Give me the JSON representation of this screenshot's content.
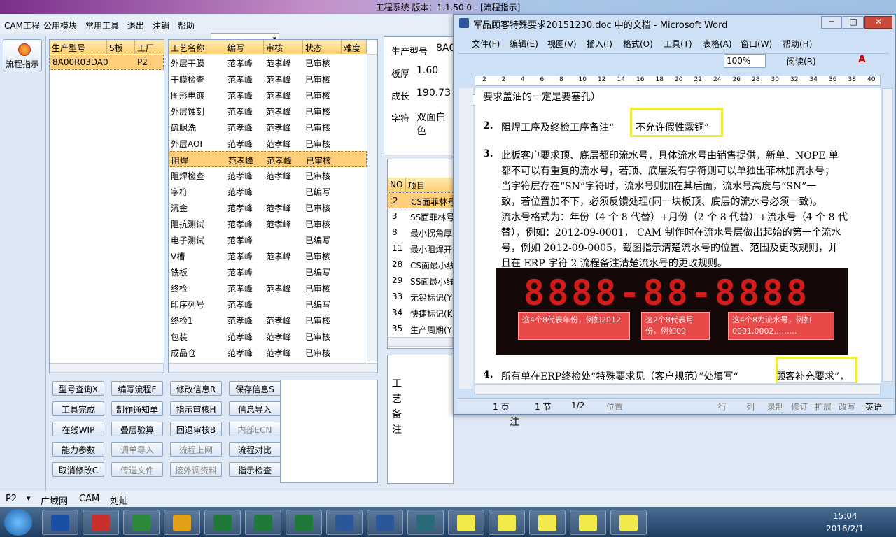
{
  "app": {
    "title": "工程系统  版本：1.1.50.0 - [流程指示]",
    "combo_value": ""
  },
  "menu": [
    "CAM工程",
    "公用模块",
    "常用工具",
    "退出",
    "注销",
    "帮助"
  ],
  "leftbar": {
    "flow_label": "流程指示"
  },
  "model_table": {
    "headers": [
      "生产型号",
      "S板",
      "工厂"
    ],
    "rows": [
      [
        "8A00R03DA0",
        "",
        "P2"
      ]
    ]
  },
  "process_table": {
    "headers": [
      "工艺名称",
      "编写",
      "审核",
      "状态",
      "难度"
    ],
    "rows": [
      [
        "外层干膜",
        "范孝峰",
        "范孝峰",
        "已审核",
        ""
      ],
      [
        "干膜检查",
        "范孝峰",
        "范孝峰",
        "已审核",
        ""
      ],
      [
        "图形电镀",
        "范孝峰",
        "范孝峰",
        "已审核",
        ""
      ],
      [
        "外层蚀刻",
        "范孝峰",
        "范孝峰",
        "已审核",
        ""
      ],
      [
        "硫脲洗",
        "范孝峰",
        "范孝峰",
        "已审核",
        ""
      ],
      [
        "外层AOI",
        "范孝峰",
        "范孝峰",
        "已审核",
        ""
      ],
      [
        "阻焊",
        "范孝峰",
        "范孝峰",
        "已审核",
        ""
      ],
      [
        "阻焊检查",
        "范孝峰",
        "范孝峰",
        "已审核",
        ""
      ],
      [
        "字符",
        "范孝峰",
        "",
        "已编写",
        ""
      ],
      [
        "沉金",
        "范孝峰",
        "范孝峰",
        "已审核",
        ""
      ],
      [
        "阻抗测试",
        "范孝峰",
        "范孝峰",
        "已审核",
        ""
      ],
      [
        "电子测试",
        "范孝峰",
        "",
        "已编写",
        ""
      ],
      [
        "V槽",
        "范孝峰",
        "范孝峰",
        "已审核",
        ""
      ],
      [
        "铣板",
        "范孝峰",
        "",
        "已编写",
        ""
      ],
      [
        "终检",
        "范孝峰",
        "范孝峰",
        "已审核",
        ""
      ],
      [
        "印序列号",
        "范孝峰",
        "",
        "已编写",
        ""
      ],
      [
        "终检1",
        "范孝峰",
        "范孝峰",
        "已审核",
        ""
      ],
      [
        "包装",
        "范孝峰",
        "范孝峰",
        "已审核",
        ""
      ],
      [
        "成品仓",
        "范孝峰",
        "范孝峰",
        "已审核",
        ""
      ]
    ],
    "selected": 6
  },
  "buttons": [
    [
      "型号查询X",
      "编写流程F",
      "修改信息R",
      "保存信息S"
    ],
    [
      "工具完成",
      "制作通知单",
      "指示审核H",
      "信息导入"
    ],
    [
      "在线WIP",
      "叠层验算",
      "回退审核B",
      "内部ECN"
    ],
    [
      "能力参数",
      "调单导入",
      "流程上网",
      "流程对比"
    ],
    [
      "取消修改C",
      "传送文件",
      "接外调资料",
      "指示检查"
    ]
  ],
  "info": {
    "model_label": "生产型号",
    "model_value": "8A0",
    "thick_label": "板厚",
    "thick_value": "1.60",
    "len_label": "成长",
    "len_value": "190.73",
    "char_label": "字符",
    "char_value": "双面白色"
  },
  "items_table": {
    "headers": [
      "NO",
      "项目"
    ],
    "rows": [
      [
        "2",
        "CS面菲林号"
      ],
      [
        "3",
        "SS面菲林号"
      ],
      [
        "8",
        "最小拐角厚"
      ],
      [
        "11",
        "最小阻焊开"
      ],
      [
        "28",
        "CS面最小线"
      ],
      [
        "29",
        "SS面最小线"
      ],
      [
        "33",
        "无铅标记(Y"
      ],
      [
        "34",
        "快捷标记(K"
      ],
      [
        "35",
        "生产周期(Y"
      ]
    ]
  },
  "note_label": "工艺备注",
  "note_label2": "注",
  "word": {
    "title": "军品顾客特殊要求20151230.doc 中的文档 - Microsoft Word",
    "menu": [
      "文件(F)",
      "编辑(E)",
      "视图(V)",
      "插入(I)",
      "格式(O)",
      "工具(T)",
      "表格(A)",
      "窗口(W)",
      "帮助(H)"
    ],
    "zoom": "100%",
    "read": "阅读(R)",
    "ruler": [
      "2",
      "2",
      "4",
      "6",
      "8",
      "10",
      "12",
      "14",
      "16",
      "18",
      "20",
      "22",
      "24",
      "26",
      "28",
      "30",
      "32",
      "34",
      "36",
      "38",
      "40"
    ],
    "lines": {
      "l0": "要求盖油的一定是要塞孔）",
      "n2": "2.",
      "l2a": "阻焊工序及终检工序备注“",
      "l2b": "不允许假性露铜”",
      "n3": "3.",
      "l3a": "此板客户要求顶、底层都印流水号，具体流水号由销售提供，新单、NOPE 单",
      "l3b": "都不可以有重复的流水号，若顶、底层没有字符则可以单独出菲林加流水号；",
      "l3c": "当字符层存在“SN”字符时，流水号则加在其后面，流水号高度与“SN”一",
      "l3d": "致，若位置加不下，必须反馈处理(同一块板顶、底层的流水号必须一致)。",
      "l3e": "流水号格式为：年份（4 个 8 代替）+月份（2 个 8 代替）+流水号（4 个 8 代",
      "l3f": "替），例如：2012-09-0001， CAM 制作时在流水号层做出起始的第一个流水",
      "l3g": "号，例如 2012-09-0005，截图指示清楚流水号的位置、范围及更改规则，并",
      "l3h": "且在 ERP 字符 2 流程备注清楚流水号的更改规则。",
      "n4": "4.",
      "l4a": "所有单在ERP终检处“特殊要求见（客户规范）”处填写“",
      "l4b": "顾客补充要求”，"
    },
    "banner": {
      "digits": "8888-88-8888",
      "b1": "这4个8代表年份，例如2012",
      "b2": "这2个8代表月份，例如09",
      "b3": "这4个8为流水号，例如0001,0002………"
    },
    "status": {
      "page": "1 页",
      "section": "1 节",
      "pos": "1/2",
      "at": "位置",
      "row": "行",
      "col": "列",
      "rec": "录制",
      "rev": "修订",
      "ext": "扩展",
      "ovr": "改写",
      "lang": "英语"
    }
  },
  "bottom": {
    "fac": "P2",
    "b1": "广域网",
    "b2": "CAM",
    "b3": "刘灿"
  },
  "clock": {
    "time": "15:04",
    "date": "2016/2/1"
  }
}
